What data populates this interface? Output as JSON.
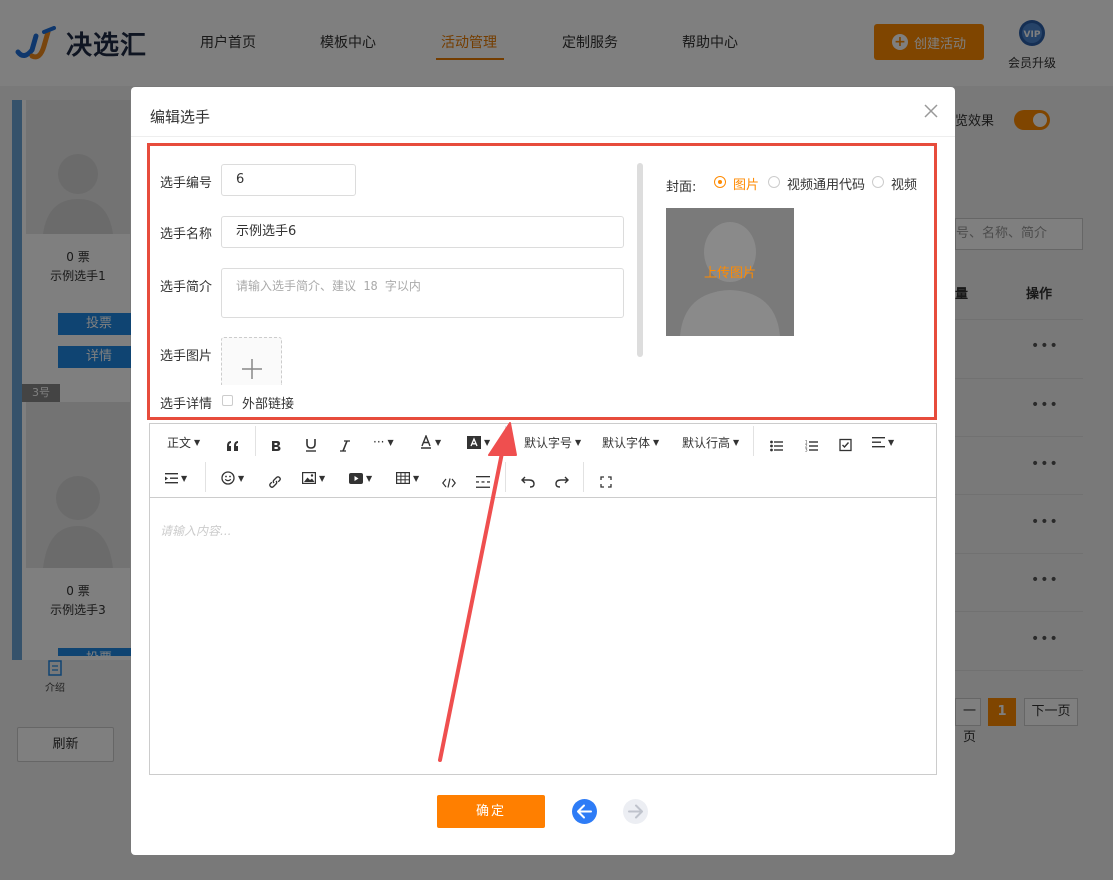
{
  "header": {
    "logo_text": "决选汇",
    "nav": [
      {
        "label": "用户首页",
        "active": false
      },
      {
        "label": "模板中心",
        "active": false
      },
      {
        "label": "活动管理",
        "active": true
      },
      {
        "label": "定制服务",
        "active": false
      },
      {
        "label": "帮助中心",
        "active": false
      }
    ],
    "create_label": "创建活动",
    "vip_badge": "VIP",
    "vip_label": "会员升级"
  },
  "background": {
    "cards": [
      {
        "votes": "0 票",
        "name": "示例选手1",
        "vote_label": "投票",
        "detail_label": "详情"
      },
      {
        "votes": "0 票",
        "name": "示例选手3",
        "vote_label": "投票"
      }
    ],
    "tag": "3号",
    "intro_label": "介绍",
    "refresh_label": "刷新",
    "preview_label": "览效果",
    "search_placeholder": "号、名称、简介",
    "column_left": "量",
    "column_ops": "操作",
    "row_more": "•••",
    "page_prev": "一页",
    "page_current": "1",
    "page_next": "下一页"
  },
  "modal": {
    "title": "编辑选手",
    "fields": {
      "number_label": "选手编号",
      "number_value": "6",
      "name_label": "选手名称",
      "name_value": "示例选手6",
      "intro_label": "选手简介",
      "intro_placeholder": "请输入选手简介、建议 18 字以内",
      "image_label": "选手图片",
      "detail_label": "选手详情",
      "external_link_label": "外部链接"
    },
    "cover": {
      "label": "封面:",
      "options": [
        {
          "label": "图片",
          "checked": true
        },
        {
          "label": "视频通用代码",
          "checked": false
        },
        {
          "label": "视频",
          "checked": false
        }
      ],
      "upload_text": "上传图片"
    },
    "toolbar": {
      "paragraph": "正文",
      "font_size": "默认字号",
      "font_family": "默认字体",
      "line_height": "默认行高",
      "more": "···"
    },
    "editor_placeholder": "请输入内容...",
    "confirm_label": "确定"
  },
  "colors": {
    "accent": "#ff8a00",
    "highlight": "#e74c3c",
    "link_blue": "#1e88e5"
  }
}
